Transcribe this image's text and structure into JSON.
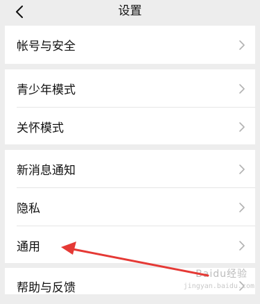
{
  "header": {
    "title": "设置",
    "back_icon": "chevron-left-icon"
  },
  "groups": [
    {
      "items": [
        {
          "label": "帐号与安全"
        }
      ]
    },
    {
      "items": [
        {
          "label": "青少年模式"
        },
        {
          "label": "关怀模式"
        }
      ]
    },
    {
      "items": [
        {
          "label": "新消息通知"
        },
        {
          "label": "隐私"
        },
        {
          "label": "通用"
        }
      ]
    },
    {
      "items": [
        {
          "label": "帮助与反馈"
        }
      ]
    }
  ],
  "annotation": {
    "arrow_color": "#e53935",
    "points_to": "通用"
  },
  "watermark": {
    "text": "Baidu经验",
    "sub": "jingyan.baidu.com"
  },
  "colors": {
    "background": "#ededed",
    "card": "#ffffff",
    "text": "#111111",
    "chevron": "#b2b2b2"
  }
}
